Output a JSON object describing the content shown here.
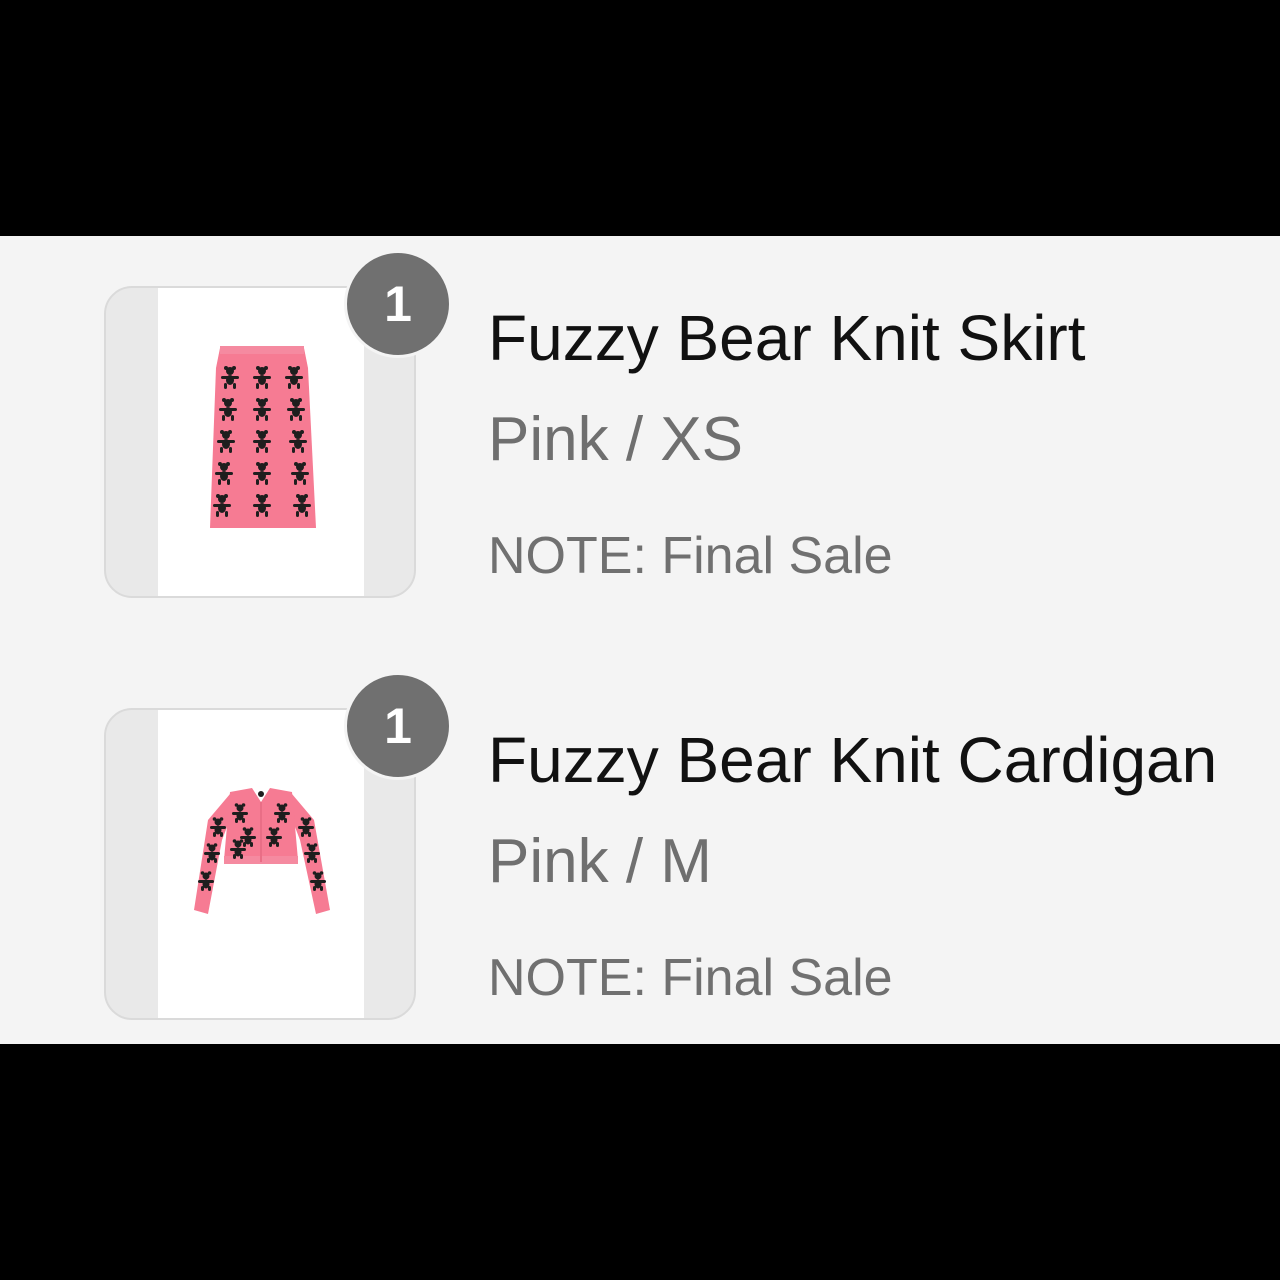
{
  "items": [
    {
      "quantity": "1",
      "title": "Fuzzy Bear Knit Skirt",
      "variant": "Pink / XS",
      "note": "NOTE: Final Sale",
      "image_icon": "pink-bear-knit-skirt-image"
    },
    {
      "quantity": "1",
      "title": "Fuzzy Bear Knit Cardigan",
      "variant": "Pink / M",
      "note": "NOTE: Final Sale",
      "image_icon": "pink-bear-knit-cardigan-image"
    }
  ],
  "colors": {
    "panel_background": "#f4f4f4",
    "badge": "#707070",
    "title_text": "#111111",
    "secondary_text": "#6f6f6f",
    "garment_pink": "#f67b93",
    "bear_pattern": "#1e1e1e"
  }
}
